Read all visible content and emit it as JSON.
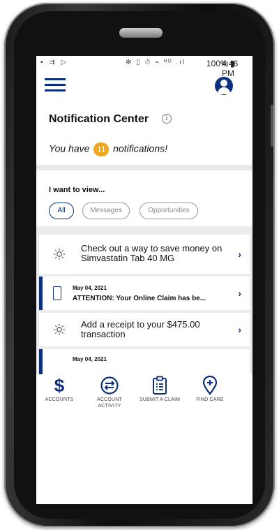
{
  "status_bar": {
    "left_icons": "▪ ⇉ ▷",
    "right_icons": "✻ ▯ ⏱ ⌁ ᴴᴰ .ıl",
    "battery": "100% ▮",
    "time": "4:46 PM"
  },
  "header": {
    "title": "Notification Center",
    "info_glyph": "i",
    "summary_prefix": "You have",
    "notification_count": "11",
    "summary_suffix": "notifications!"
  },
  "filter": {
    "label": "I want to view...",
    "options": [
      {
        "label": "All",
        "selected": true
      },
      {
        "label": "Messages",
        "selected": false
      },
      {
        "label": "Opportunities",
        "selected": false
      }
    ]
  },
  "notifications": [
    {
      "type": "opportunity",
      "icon": "lightbulb-icon",
      "text": "Check out a way to save money on Simvastatin Tab 40 MG"
    },
    {
      "type": "message",
      "icon": "phone-icon",
      "date": "May 04, 2021",
      "headline": "ATTENTION: Your Online Claim has be..."
    },
    {
      "type": "opportunity",
      "icon": "lightbulb-icon",
      "text": "Add a receipt to your $475.00 transaction"
    },
    {
      "type": "message",
      "icon": "phone-icon",
      "date": "May 04, 2021",
      "headline": ""
    }
  ],
  "bottom_nav": [
    {
      "label": "ACCOUNTS",
      "icon": "dollar-icon"
    },
    {
      "label": "ACCOUNT ACTIVITY",
      "icon": "transfer-icon"
    },
    {
      "label": "SUBMIT A CLAIM",
      "icon": "clipboard-icon"
    },
    {
      "label": "FIND CARE",
      "icon": "location-pin-icon"
    }
  ],
  "colors": {
    "brand": "#0b2f7a",
    "badge": "#f1a51a",
    "feed_background": "#ececec"
  }
}
